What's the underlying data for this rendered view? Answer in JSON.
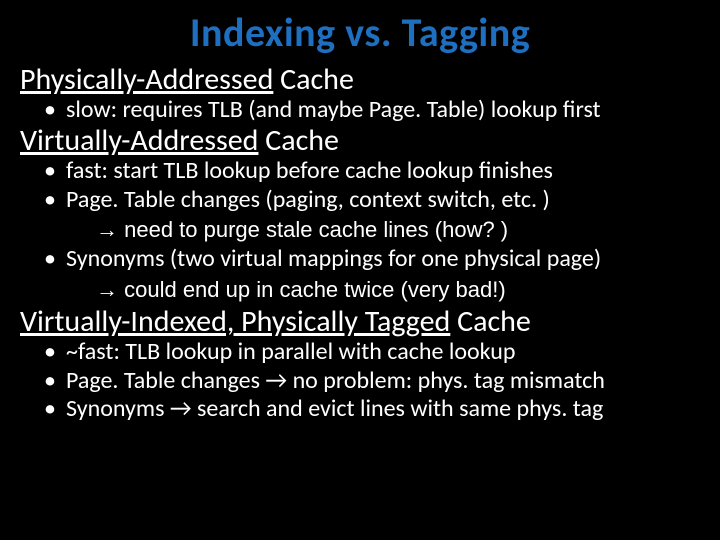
{
  "title": "Indexing vs. Tagging",
  "sec1": {
    "heading_ul": "Physically-Addressed",
    "heading_rest": " Cache",
    "b1": "slow: requires TLB (and maybe Page. Table) lookup first"
  },
  "sec2": {
    "heading_ul": "Virtually-Addressed",
    "heading_rest": " Cache",
    "b1": "fast: start TLB lookup before cache lookup finishes",
    "b2": "Page. Table changes (paging, context switch, etc. )",
    "b2_sub": "→ need to purge stale cache lines (how? )",
    "b3": "Synonyms (two virtual mappings for one physical page)",
    "b3_sub": "→ could end up in cache twice (very bad!)"
  },
  "sec3": {
    "heading_ul": "Virtually-Indexed, Physically Tagged",
    "heading_rest": " Cache",
    "b1": "~fast: TLB lookup in parallel with cache lookup",
    "b2": "Page. Table changes → no problem: phys. tag mismatch",
    "b3": "Synonyms → search and evict lines with same phys. tag"
  }
}
